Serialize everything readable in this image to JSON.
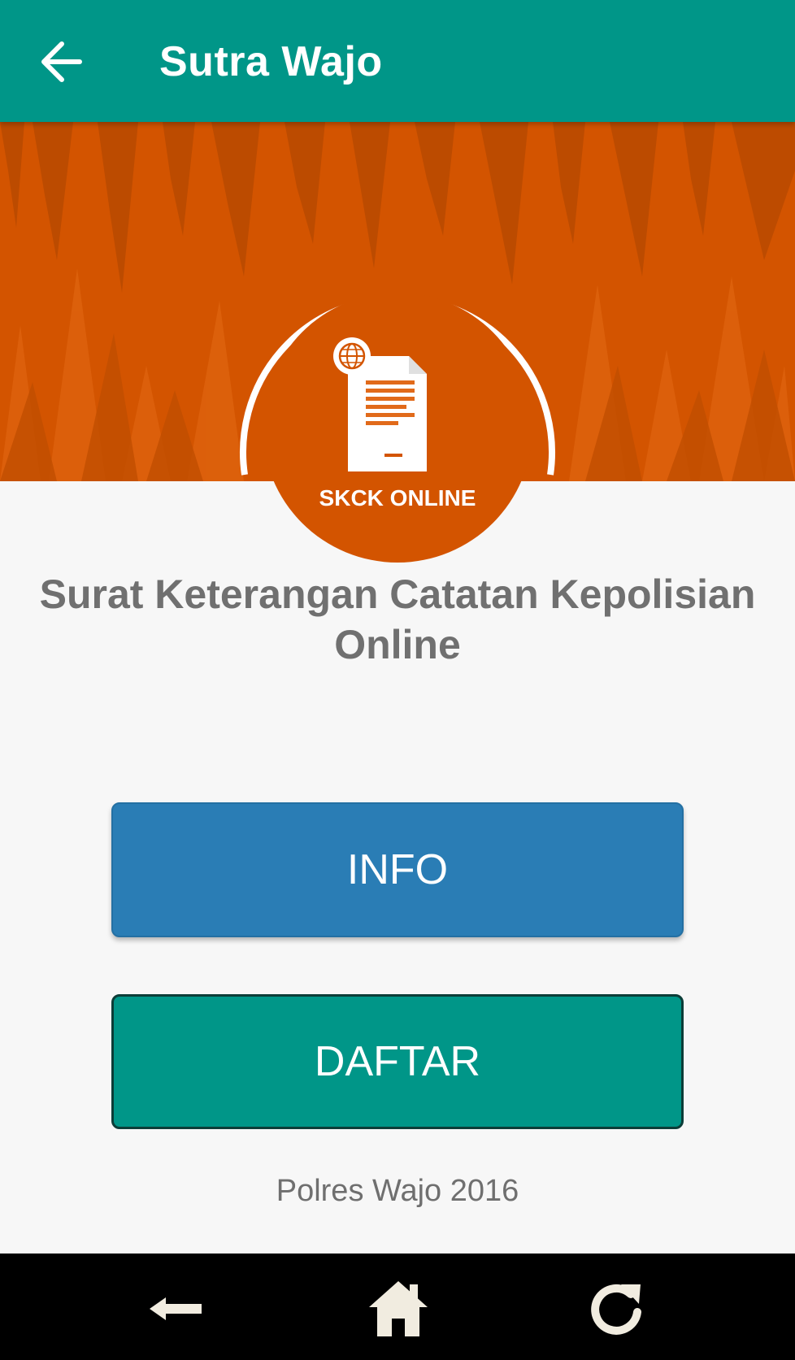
{
  "app_bar": {
    "title": "Sutra Wajo",
    "back_icon": "arrow-left-icon",
    "background": "#009688"
  },
  "banner": {
    "background": "#d35400"
  },
  "logo": {
    "label": "SKCK ONLINE",
    "icon": "document-globe-icon"
  },
  "headline": "Surat Keterangan Catatan Kepolisian Online",
  "buttons": {
    "info": {
      "label": "INFO",
      "color": "#2a7db5"
    },
    "daftar": {
      "label": "DAFTAR",
      "color": "#009688"
    }
  },
  "footer": "Polres Wajo 2016",
  "system_nav": {
    "back_icon": "back-arrow-icon",
    "home_icon": "home-icon",
    "refresh_icon": "refresh-icon"
  }
}
